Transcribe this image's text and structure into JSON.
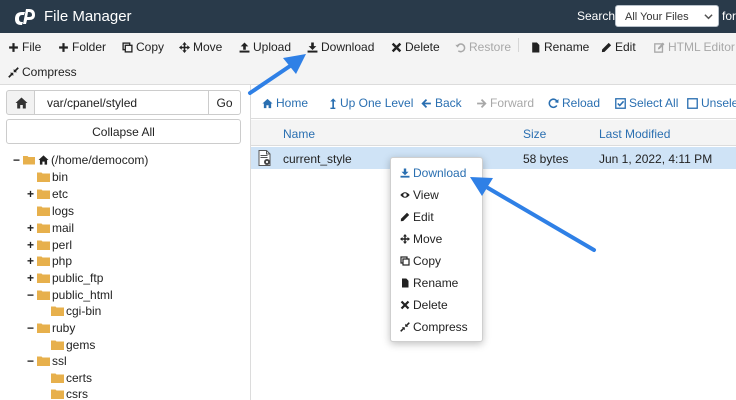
{
  "header": {
    "app_title": "File Manager",
    "search_label": "Search",
    "search_scope": "All Your Files",
    "search_for": "for"
  },
  "toolbar": {
    "file": "File",
    "folder": "Folder",
    "copy": "Copy",
    "move": "Move",
    "upload": "Upload",
    "download": "Download",
    "delete": "Delete",
    "restore": "Restore",
    "rename": "Rename",
    "edit": "Edit",
    "html_editor": "HTML Editor",
    "compress": "Compress"
  },
  "address": {
    "path": "var/cpanel/styled",
    "go": "Go"
  },
  "sidebar": {
    "collapse_all": "Collapse All",
    "root": "(/home/democom)",
    "tree": [
      {
        "label": "bin"
      },
      {
        "label": "etc"
      },
      {
        "label": "logs"
      },
      {
        "label": "mail"
      },
      {
        "label": "perl"
      },
      {
        "label": "php"
      },
      {
        "label": "public_ftp"
      },
      {
        "label": "public_html"
      },
      {
        "label": "cgi-bin"
      },
      {
        "label": "ruby"
      },
      {
        "label": "gems"
      },
      {
        "label": "ssl"
      },
      {
        "label": "certs"
      },
      {
        "label": "csrs"
      }
    ]
  },
  "nav": {
    "home": "Home",
    "up_one_level": "Up One Level",
    "back": "Back",
    "forward": "Forward",
    "reload": "Reload",
    "select_all": "Select All",
    "unselect_all": "Unselect All"
  },
  "table": {
    "columns": {
      "name": "Name",
      "size": "Size",
      "last_modified": "Last Modified"
    },
    "rows": [
      {
        "name": "current_style",
        "size": "58 bytes",
        "last_modified": "Jun 1, 2022, 4:11 PM"
      }
    ]
  },
  "context_menu": {
    "items": [
      "Download",
      "View",
      "Edit",
      "Move",
      "Copy",
      "Rename",
      "Delete",
      "Compress"
    ]
  },
  "colors": {
    "header_bg": "#293a4a",
    "link_blue": "#2a6fb1",
    "selected_row": "#cfe3f6",
    "folder": "#e7b04c",
    "annotation_arrow": "#2f80e6"
  },
  "icons": {
    "logo": "cpanel-logo-icon",
    "toolbar": [
      "plus-icon",
      "plus-icon",
      "copy-icon",
      "move-icon",
      "upload-icon",
      "download-icon",
      "close-icon",
      "restore-icon",
      "file-icon",
      "pencil-icon",
      "edit-icon",
      "compress-icon"
    ],
    "context": [
      "download-icon",
      "eye-icon",
      "pencil-icon",
      "move-icon",
      "copy-icon",
      "file-icon",
      "close-icon",
      "compress-icon"
    ]
  }
}
